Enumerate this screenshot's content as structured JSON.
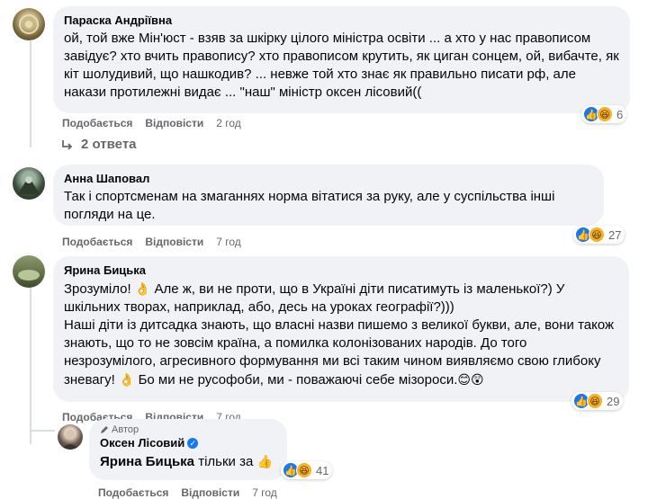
{
  "comments": [
    {
      "author": "Параска Андріївна",
      "text": "ой, той вже Мін'юст - взяв за шкірку цілого міністра освіти ... а хто у нас правописом завідує? хто вчить правопису? хто правописом крутить, як циган сонцем, ой, вибачте, як кіт шолудивий, що нашкодив? ... невже той хто знає як правильно писати рф, але накази протилежні видає ... \"наш\" міністр оксен лісовий((",
      "like_label": "Подобається",
      "reply_label": "Відповісти",
      "time": "2 год",
      "reaction_count": "6"
    },
    {
      "author": "Анна Шаповал",
      "text": "Так і спортсменам на змаганнях норма вітатися за руку, але у суспільства інші погляди на це.",
      "like_label": "Подобається",
      "reply_label": "Відповісти",
      "time": "7 год",
      "reaction_count": "27"
    },
    {
      "author": "Ярина Бицька",
      "text_a": "Зрозуміло!",
      "text_b": "Але ж, ви не проти, що в Україні діти писатимуть із маленької?) У шкільних творах, наприклад, або, десь на уроках географії?)))",
      "text_c": "Наші діти із дитсадка знають, що власні назви пишемо з великої букви, але, вони також знають, що то не зовсім країна, а помилка колонізованих народів. До того незрозумілого, агресивного формування ми всі таким чином виявляємо свою глибоку зневагу!",
      "text_d": "Бо ми не русофоби, ми - поважаючі себе мізороси.",
      "like_label": "Подобається",
      "reply_label": "Відповісти",
      "time": "7 год",
      "reaction_count": "29"
    }
  ],
  "replies_link": "2 ответа",
  "reply": {
    "author_badge": "Автор",
    "author": "Оксен Лісовий",
    "mention": "Ярина Бицька",
    "text": "тільки за",
    "like_label": "Подобається",
    "reply_label": "Відповісти",
    "time": "7 год",
    "reaction_count": "41"
  },
  "icons": {
    "like": "like-reaction-icon",
    "haha": "haha-reaction-icon",
    "verified": "verified-badge-icon",
    "reply_arrow": "reply-arrow-icon",
    "pen": "author-pen-icon"
  },
  "colors": {
    "bubble": "#f0f2f5",
    "meta": "#65676b",
    "like_blue": "#1877f2",
    "haha_yellow": "#f7b125"
  }
}
